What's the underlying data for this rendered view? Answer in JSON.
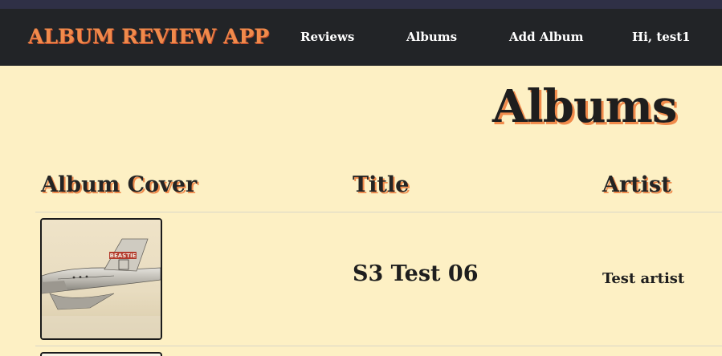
{
  "app": {
    "brand": "ALBUM REVIEW APP"
  },
  "nav": {
    "reviews": "Reviews",
    "albums": "Albums",
    "add_album": "Add Album",
    "greeting": "Hi, test1"
  },
  "page": {
    "title": "Albums"
  },
  "table": {
    "headers": [
      "Album Cover",
      "Title",
      "Artist"
    ],
    "rows": [
      {
        "cover_text": "BEASTIE",
        "title": "S3 Test 06",
        "artist": "Test artist"
      }
    ]
  },
  "colors": {
    "background": "#fdf0c4",
    "navbar": "#222427",
    "accent": "#f08a4b"
  }
}
